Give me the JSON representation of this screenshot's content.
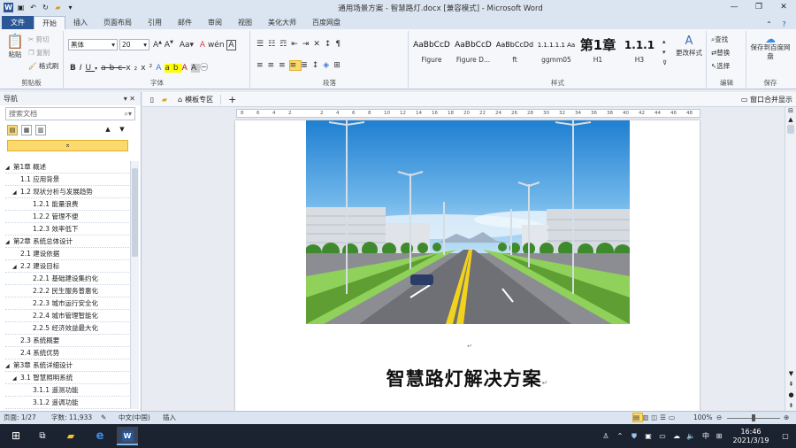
{
  "window": {
    "title": "通用场景方案 - 智慧路灯.docx [兼容模式] - Microsoft Word",
    "minimize": "—",
    "restore": "❐",
    "close": "✕"
  },
  "ribbon_tabs": [
    "文件",
    "开始",
    "插入",
    "页面布局",
    "引用",
    "邮件",
    "审阅",
    "视图",
    "美化大师",
    "百度网盘"
  ],
  "clipboard": {
    "paste": "粘贴",
    "cut": "剪切",
    "copy": "复制",
    "painter": "格式刷",
    "label": "剪贴板"
  },
  "font": {
    "name": "黑体",
    "size": "20",
    "label": "字体"
  },
  "paragraph": {
    "label": "段落"
  },
  "styles": {
    "label": "样式",
    "items": [
      {
        "sample": "AaBbCcD",
        "name": "Figure"
      },
      {
        "sample": "AaBbCcD",
        "name": "Figure D..."
      },
      {
        "sample": "AaBbCcDd",
        "name": "ft"
      },
      {
        "sample": "1.1.1.1.1 Aa",
        "name": "ggmm05"
      },
      {
        "sample": "第1章",
        "name": "H1"
      },
      {
        "sample": "1.1.1",
        "name": "H2"
      },
      {
        "sample": "1.1.1 A",
        "name": "H3"
      }
    ],
    "change": "更改样式"
  },
  "editing": {
    "find": "查找",
    "replace": "替换",
    "select": "选择",
    "label": "编辑"
  },
  "save": {
    "baidu": "保存到百度网盘",
    "label": "保存"
  },
  "nav": {
    "title": "导航",
    "search_placeholder": "搜索文档",
    "items": [
      {
        "text": "第1章 概述",
        "level": 1
      },
      {
        "text": "1.1 应用背景",
        "level": 2
      },
      {
        "text": "1.2 现状分析与发展趋势",
        "level": 2
      },
      {
        "text": "1.2.1 能量浪费",
        "level": 3
      },
      {
        "text": "1.2.2 管理不便",
        "level": 3
      },
      {
        "text": "1.2.3 效率低下",
        "level": 3
      },
      {
        "text": "第2章 系统总体设计",
        "level": 1
      },
      {
        "text": "2.1 建设依据",
        "level": 2
      },
      {
        "text": "2.2 建设目标",
        "level": 2
      },
      {
        "text": "2.2.1 基础建设集约化",
        "level": 3
      },
      {
        "text": "2.2.2 民生服务普惠化",
        "level": 3
      },
      {
        "text": "2.2.3 城市运行安全化",
        "level": 3
      },
      {
        "text": "2.2.4 城市管理智能化",
        "level": 3
      },
      {
        "text": "2.2.5 经济效益最大化",
        "level": 3
      },
      {
        "text": "2.3 系统概要",
        "level": 2
      },
      {
        "text": "2.4 系统优势",
        "level": 2
      },
      {
        "text": "第3章 系统详细设计",
        "level": 1
      },
      {
        "text": "3.1 智慧照明系统",
        "level": 2
      },
      {
        "text": "3.1.1 遥测功能",
        "level": 3
      },
      {
        "text": "3.1.2 遥调功能",
        "level": 3
      }
    ]
  },
  "doc_tabs": {
    "template": "模板专区",
    "window_all": "窗口合并显示"
  },
  "document": {
    "title": "智慧路灯解决方案"
  },
  "status": {
    "page": "页面: 1/27",
    "words": "字数: 11,933",
    "lang": "中文(中国)",
    "insert": "插入",
    "zoom": "100%"
  },
  "taskbar": {
    "time": "16:46",
    "date": "2021/3/19",
    "ime": "中"
  }
}
